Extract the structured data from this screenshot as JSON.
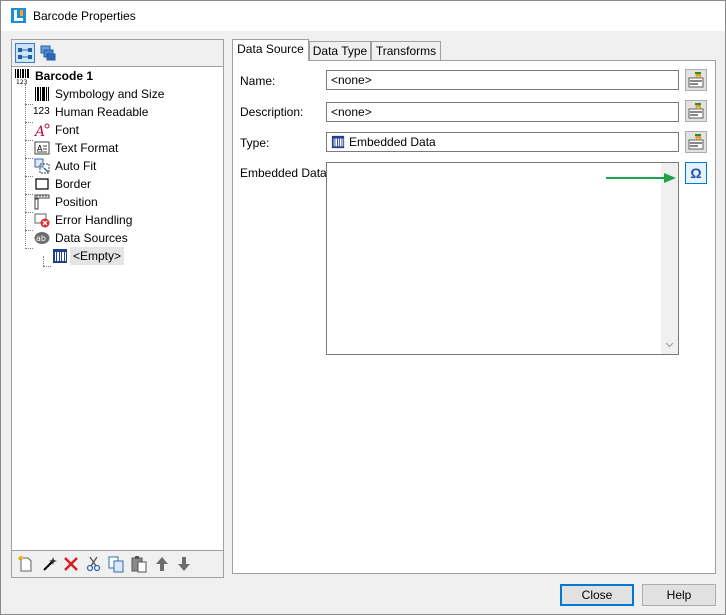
{
  "window": {
    "title": "Barcode Properties"
  },
  "tree": {
    "root": "Barcode 1",
    "items": [
      {
        "label": "Symbology and Size",
        "icon": "barcode-icon"
      },
      {
        "label": "Human Readable",
        "icon": "human-readable-icon"
      },
      {
        "label": "Font",
        "icon": "font-icon"
      },
      {
        "label": "Text Format",
        "icon": "text-format-icon"
      },
      {
        "label": "Auto Fit",
        "icon": "auto-fit-icon"
      },
      {
        "label": "Border",
        "icon": "border-icon"
      },
      {
        "label": "Position",
        "icon": "position-icon"
      },
      {
        "label": "Error Handling",
        "icon": "error-handling-icon"
      },
      {
        "label": "Data Sources",
        "icon": "data-sources-icon"
      }
    ],
    "child": {
      "label": "<Empty>",
      "icon": "embedded-data-icon"
    },
    "human_readable_prefix": "123"
  },
  "tabs": [
    {
      "label": "Data Source",
      "active": true
    },
    {
      "label": "Data Type",
      "active": false
    },
    {
      "label": "Transforms",
      "active": false
    }
  ],
  "form": {
    "name_label": "Name:",
    "name_value": "<none>",
    "description_label": "Description:",
    "description_value": "<none>",
    "type_label": "Type:",
    "type_value": "Embedded Data",
    "embedded_label": "Embedded Data:",
    "embedded_value": "",
    "special_char_glyph": "Ω"
  },
  "buttons": {
    "close": "Close",
    "help": "Help"
  },
  "colors": {
    "arrow": "#1fa24a",
    "accent": "#0078d7"
  }
}
